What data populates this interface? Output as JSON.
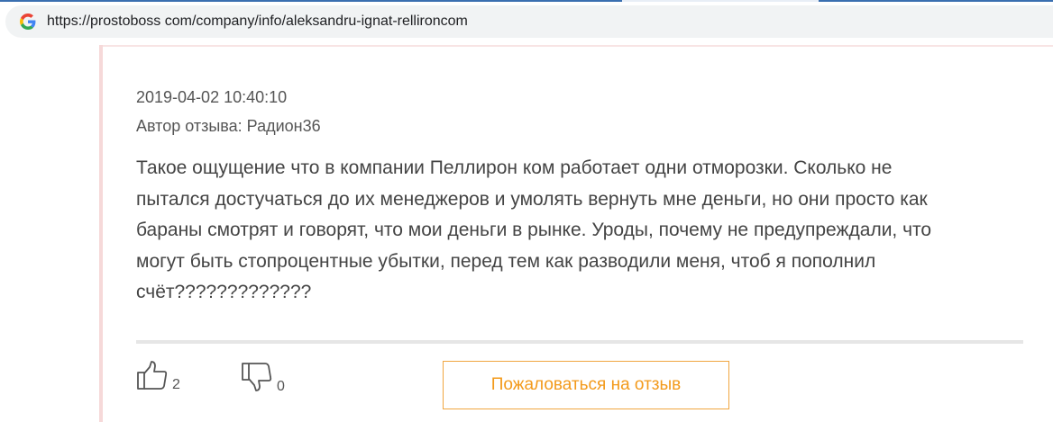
{
  "browser": {
    "url": "https://prostoboss com/company/info/aleksandru-ignat-rellironcom"
  },
  "review": {
    "date": "2019-04-02 10:40:10",
    "author": "Автор отзыва: Радион36",
    "lines": [
      "Такое ощущение что в компании Пеллирон ком работает одни отморозки. Сколько не",
      "пытался достучаться до их менеджеров и умолять вернуть мне деньги, но они просто как",
      "бараны смотрят и говорят, что мои деньги в рынке. Уроды, почему не предупреждали, что",
      "могут быть стопроцентные убытки, перед тем как разводили меня, чтоб я пополнил",
      "счёт?????????????"
    ]
  },
  "votes": {
    "likes": "2",
    "dislikes": "0"
  },
  "actions": {
    "complain_label": "Пожаловаться на отзыв"
  },
  "colors": {
    "accent": "#f39a1b",
    "border_accent": "#f0a640",
    "left_border": "#f6d9d9"
  },
  "icons": [
    "google-g-icon",
    "thumbs-up-icon",
    "thumbs-down-icon"
  ]
}
